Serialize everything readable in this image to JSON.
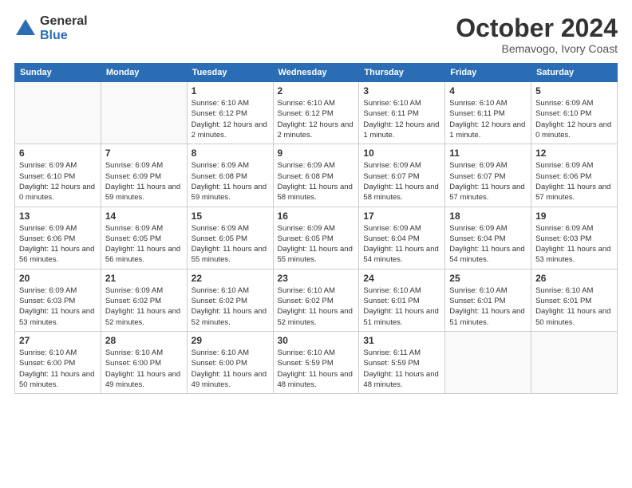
{
  "logo": {
    "general": "General",
    "blue": "Blue"
  },
  "header": {
    "month": "October 2024",
    "location": "Bemavogo, Ivory Coast"
  },
  "weekdays": [
    "Sunday",
    "Monday",
    "Tuesday",
    "Wednesday",
    "Thursday",
    "Friday",
    "Saturday"
  ],
  "weeks": [
    [
      {
        "day": "",
        "info": ""
      },
      {
        "day": "",
        "info": ""
      },
      {
        "day": "1",
        "info": "Sunrise: 6:10 AM\nSunset: 6:12 PM\nDaylight: 12 hours and 2 minutes."
      },
      {
        "day": "2",
        "info": "Sunrise: 6:10 AM\nSunset: 6:12 PM\nDaylight: 12 hours and 2 minutes."
      },
      {
        "day": "3",
        "info": "Sunrise: 6:10 AM\nSunset: 6:11 PM\nDaylight: 12 hours and 1 minute."
      },
      {
        "day": "4",
        "info": "Sunrise: 6:10 AM\nSunset: 6:11 PM\nDaylight: 12 hours and 1 minute."
      },
      {
        "day": "5",
        "info": "Sunrise: 6:09 AM\nSunset: 6:10 PM\nDaylight: 12 hours and 0 minutes."
      }
    ],
    [
      {
        "day": "6",
        "info": "Sunrise: 6:09 AM\nSunset: 6:10 PM\nDaylight: 12 hours and 0 minutes."
      },
      {
        "day": "7",
        "info": "Sunrise: 6:09 AM\nSunset: 6:09 PM\nDaylight: 11 hours and 59 minutes."
      },
      {
        "day": "8",
        "info": "Sunrise: 6:09 AM\nSunset: 6:08 PM\nDaylight: 11 hours and 59 minutes."
      },
      {
        "day": "9",
        "info": "Sunrise: 6:09 AM\nSunset: 6:08 PM\nDaylight: 11 hours and 58 minutes."
      },
      {
        "day": "10",
        "info": "Sunrise: 6:09 AM\nSunset: 6:07 PM\nDaylight: 11 hours and 58 minutes."
      },
      {
        "day": "11",
        "info": "Sunrise: 6:09 AM\nSunset: 6:07 PM\nDaylight: 11 hours and 57 minutes."
      },
      {
        "day": "12",
        "info": "Sunrise: 6:09 AM\nSunset: 6:06 PM\nDaylight: 11 hours and 57 minutes."
      }
    ],
    [
      {
        "day": "13",
        "info": "Sunrise: 6:09 AM\nSunset: 6:06 PM\nDaylight: 11 hours and 56 minutes."
      },
      {
        "day": "14",
        "info": "Sunrise: 6:09 AM\nSunset: 6:05 PM\nDaylight: 11 hours and 56 minutes."
      },
      {
        "day": "15",
        "info": "Sunrise: 6:09 AM\nSunset: 6:05 PM\nDaylight: 11 hours and 55 minutes."
      },
      {
        "day": "16",
        "info": "Sunrise: 6:09 AM\nSunset: 6:05 PM\nDaylight: 11 hours and 55 minutes."
      },
      {
        "day": "17",
        "info": "Sunrise: 6:09 AM\nSunset: 6:04 PM\nDaylight: 11 hours and 54 minutes."
      },
      {
        "day": "18",
        "info": "Sunrise: 6:09 AM\nSunset: 6:04 PM\nDaylight: 11 hours and 54 minutes."
      },
      {
        "day": "19",
        "info": "Sunrise: 6:09 AM\nSunset: 6:03 PM\nDaylight: 11 hours and 53 minutes."
      }
    ],
    [
      {
        "day": "20",
        "info": "Sunrise: 6:09 AM\nSunset: 6:03 PM\nDaylight: 11 hours and 53 minutes."
      },
      {
        "day": "21",
        "info": "Sunrise: 6:09 AM\nSunset: 6:02 PM\nDaylight: 11 hours and 52 minutes."
      },
      {
        "day": "22",
        "info": "Sunrise: 6:10 AM\nSunset: 6:02 PM\nDaylight: 11 hours and 52 minutes."
      },
      {
        "day": "23",
        "info": "Sunrise: 6:10 AM\nSunset: 6:02 PM\nDaylight: 11 hours and 52 minutes."
      },
      {
        "day": "24",
        "info": "Sunrise: 6:10 AM\nSunset: 6:01 PM\nDaylight: 11 hours and 51 minutes."
      },
      {
        "day": "25",
        "info": "Sunrise: 6:10 AM\nSunset: 6:01 PM\nDaylight: 11 hours and 51 minutes."
      },
      {
        "day": "26",
        "info": "Sunrise: 6:10 AM\nSunset: 6:01 PM\nDaylight: 11 hours and 50 minutes."
      }
    ],
    [
      {
        "day": "27",
        "info": "Sunrise: 6:10 AM\nSunset: 6:00 PM\nDaylight: 11 hours and 50 minutes."
      },
      {
        "day": "28",
        "info": "Sunrise: 6:10 AM\nSunset: 6:00 PM\nDaylight: 11 hours and 49 minutes."
      },
      {
        "day": "29",
        "info": "Sunrise: 6:10 AM\nSunset: 6:00 PM\nDaylight: 11 hours and 49 minutes."
      },
      {
        "day": "30",
        "info": "Sunrise: 6:10 AM\nSunset: 5:59 PM\nDaylight: 11 hours and 48 minutes."
      },
      {
        "day": "31",
        "info": "Sunrise: 6:11 AM\nSunset: 5:59 PM\nDaylight: 11 hours and 48 minutes."
      },
      {
        "day": "",
        "info": ""
      },
      {
        "day": "",
        "info": ""
      }
    ]
  ]
}
